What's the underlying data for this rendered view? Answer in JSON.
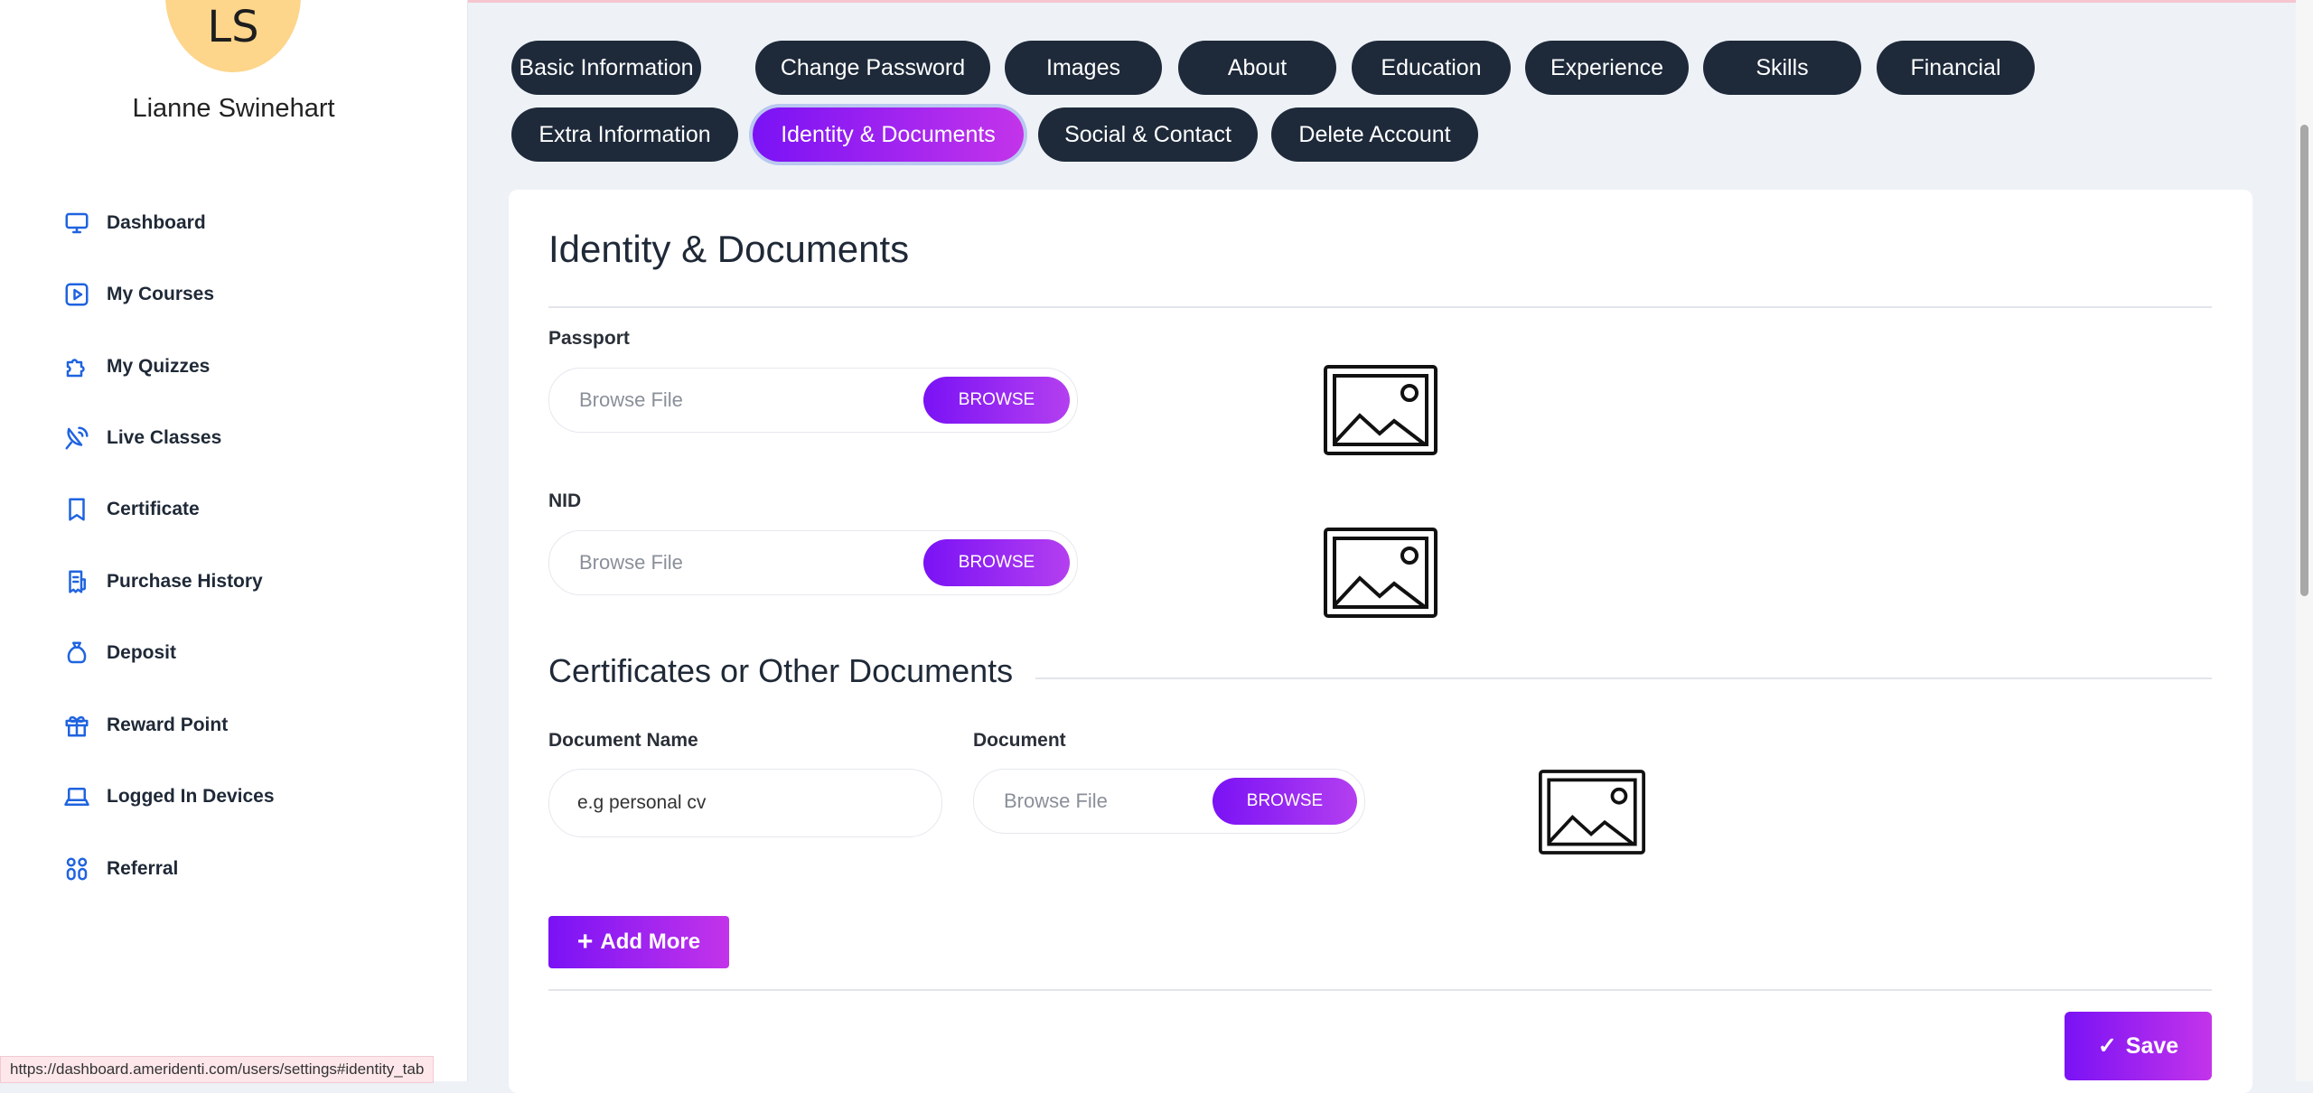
{
  "user": {
    "initials": "LS",
    "name": "Lianne Swinehart"
  },
  "sidebar": {
    "items": [
      {
        "label": "Dashboard",
        "icon": "monitor-icon"
      },
      {
        "label": "My Courses",
        "icon": "play-square-icon"
      },
      {
        "label": "My Quizzes",
        "icon": "puzzle-icon"
      },
      {
        "label": "Live Classes",
        "icon": "satellite-dish-icon"
      },
      {
        "label": "Certificate",
        "icon": "bookmark-icon"
      },
      {
        "label": "Purchase History",
        "icon": "receipt-icon"
      },
      {
        "label": "Deposit",
        "icon": "money-bag-icon"
      },
      {
        "label": "Reward Point",
        "icon": "gift-icon"
      },
      {
        "label": "Logged In Devices",
        "icon": "laptop-icon"
      },
      {
        "label": "Referral",
        "icon": "users-icon"
      }
    ]
  },
  "tabs": [
    {
      "label": "Basic Information"
    },
    {
      "label": "Change Password"
    },
    {
      "label": "Images"
    },
    {
      "label": "About"
    },
    {
      "label": "Education"
    },
    {
      "label": "Experience"
    },
    {
      "label": "Skills"
    },
    {
      "label": "Financial"
    },
    {
      "label": "Extra Information"
    },
    {
      "label": "Identity & Documents",
      "active": true
    },
    {
      "label": "Social & Contact"
    },
    {
      "label": "Delete Account"
    }
  ],
  "main": {
    "title": "Identity & Documents",
    "passport": {
      "label": "Passport",
      "placeholder": "Browse File",
      "button": "BROWSE",
      "preview_icon": "image-placeholder-icon"
    },
    "nid": {
      "label": "NID",
      "placeholder": "Browse File",
      "button": "BROWSE",
      "preview_icon": "image-placeholder-icon"
    },
    "certificates": {
      "title": "Certificates or Other Documents",
      "doc_name_label": "Document Name",
      "doc_name_value": "e.g personal cv",
      "document_label": "Document",
      "placeholder": "Browse File",
      "button": "BROWSE",
      "preview_icon": "image-placeholder-icon"
    },
    "add_more": "Add More",
    "save": "Save"
  },
  "status_url": "https://dashboard.ameridenti.com/users/settings#identity_tab",
  "colors": {
    "accent_start": "#7a12f5",
    "accent_end": "#c334ea",
    "tab_dark": "#1e2a3a",
    "icon_blue": "#1f63e0"
  }
}
